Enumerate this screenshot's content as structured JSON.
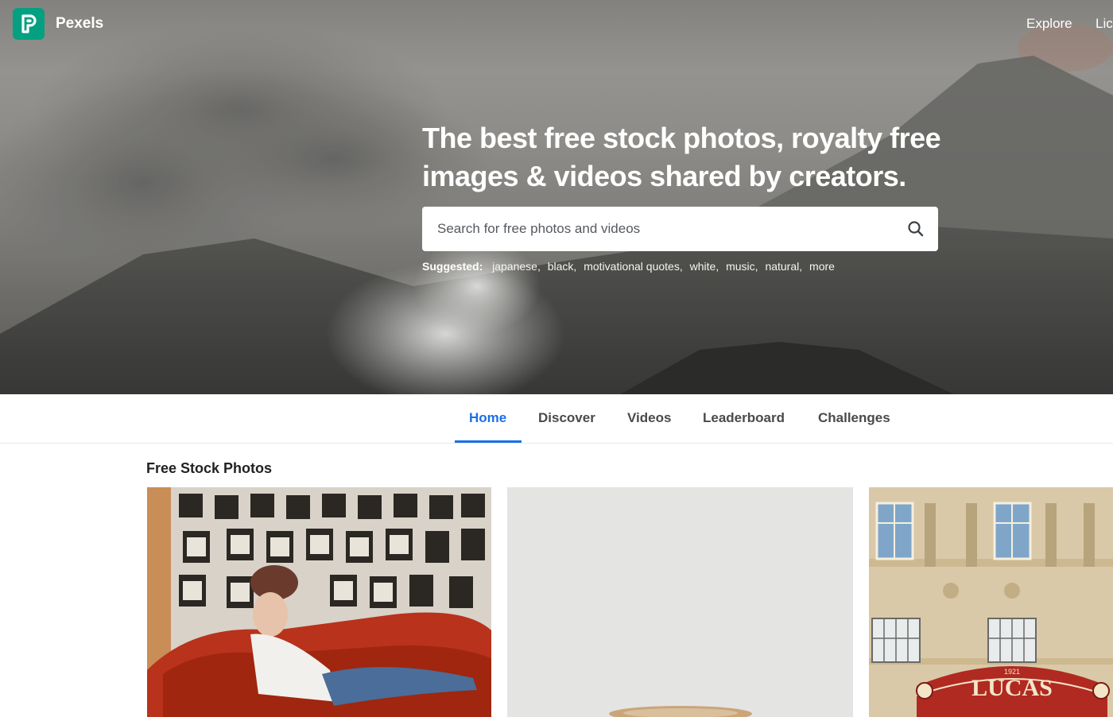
{
  "brand": {
    "name": "Pexels",
    "logo_letter": "P",
    "accent": "#05a081"
  },
  "top_nav": {
    "explore": "Explore",
    "license": "Lic"
  },
  "hero": {
    "headline": "The best free stock photos, royalty free images & videos shared by creators.",
    "search": {
      "placeholder": "Search for free photos and videos",
      "value": ""
    },
    "suggested_label": "Suggested:",
    "suggestions": [
      "japanese",
      "black",
      "motivational quotes",
      "white",
      "music",
      "natural",
      "more"
    ]
  },
  "tabs": [
    {
      "label": "Home",
      "active": true
    },
    {
      "label": "Discover",
      "active": false
    },
    {
      "label": "Videos",
      "active": false
    },
    {
      "label": "Leaderboard",
      "active": false
    },
    {
      "label": "Challenges",
      "active": false
    }
  ],
  "colors": {
    "active_tab": "#1a6fe8"
  },
  "section": {
    "title": "Free Stock Photos"
  },
  "photos": [
    {
      "subject": "woman on red sofa"
    },
    {
      "subject": "coffee cup"
    },
    {
      "subject": "Lucas theatre facade",
      "sign_text": "LUCAS",
      "year_text": "1921"
    }
  ]
}
